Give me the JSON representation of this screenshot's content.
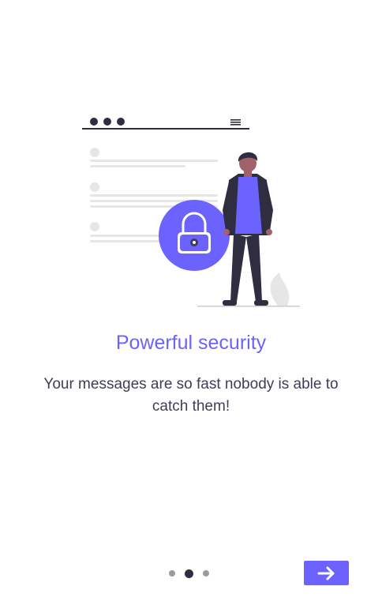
{
  "slide": {
    "title": "Powerful security",
    "description": "Your messages are so fast nobody is able to catch them!"
  },
  "illustration": {
    "icon": "security-lock-icon",
    "accent_color": "#6c63ff",
    "dark_color": "#2f2e41"
  },
  "pager": {
    "current_page": 2,
    "total_pages": 3
  },
  "next_button": {
    "icon": "arrow-right-icon"
  }
}
